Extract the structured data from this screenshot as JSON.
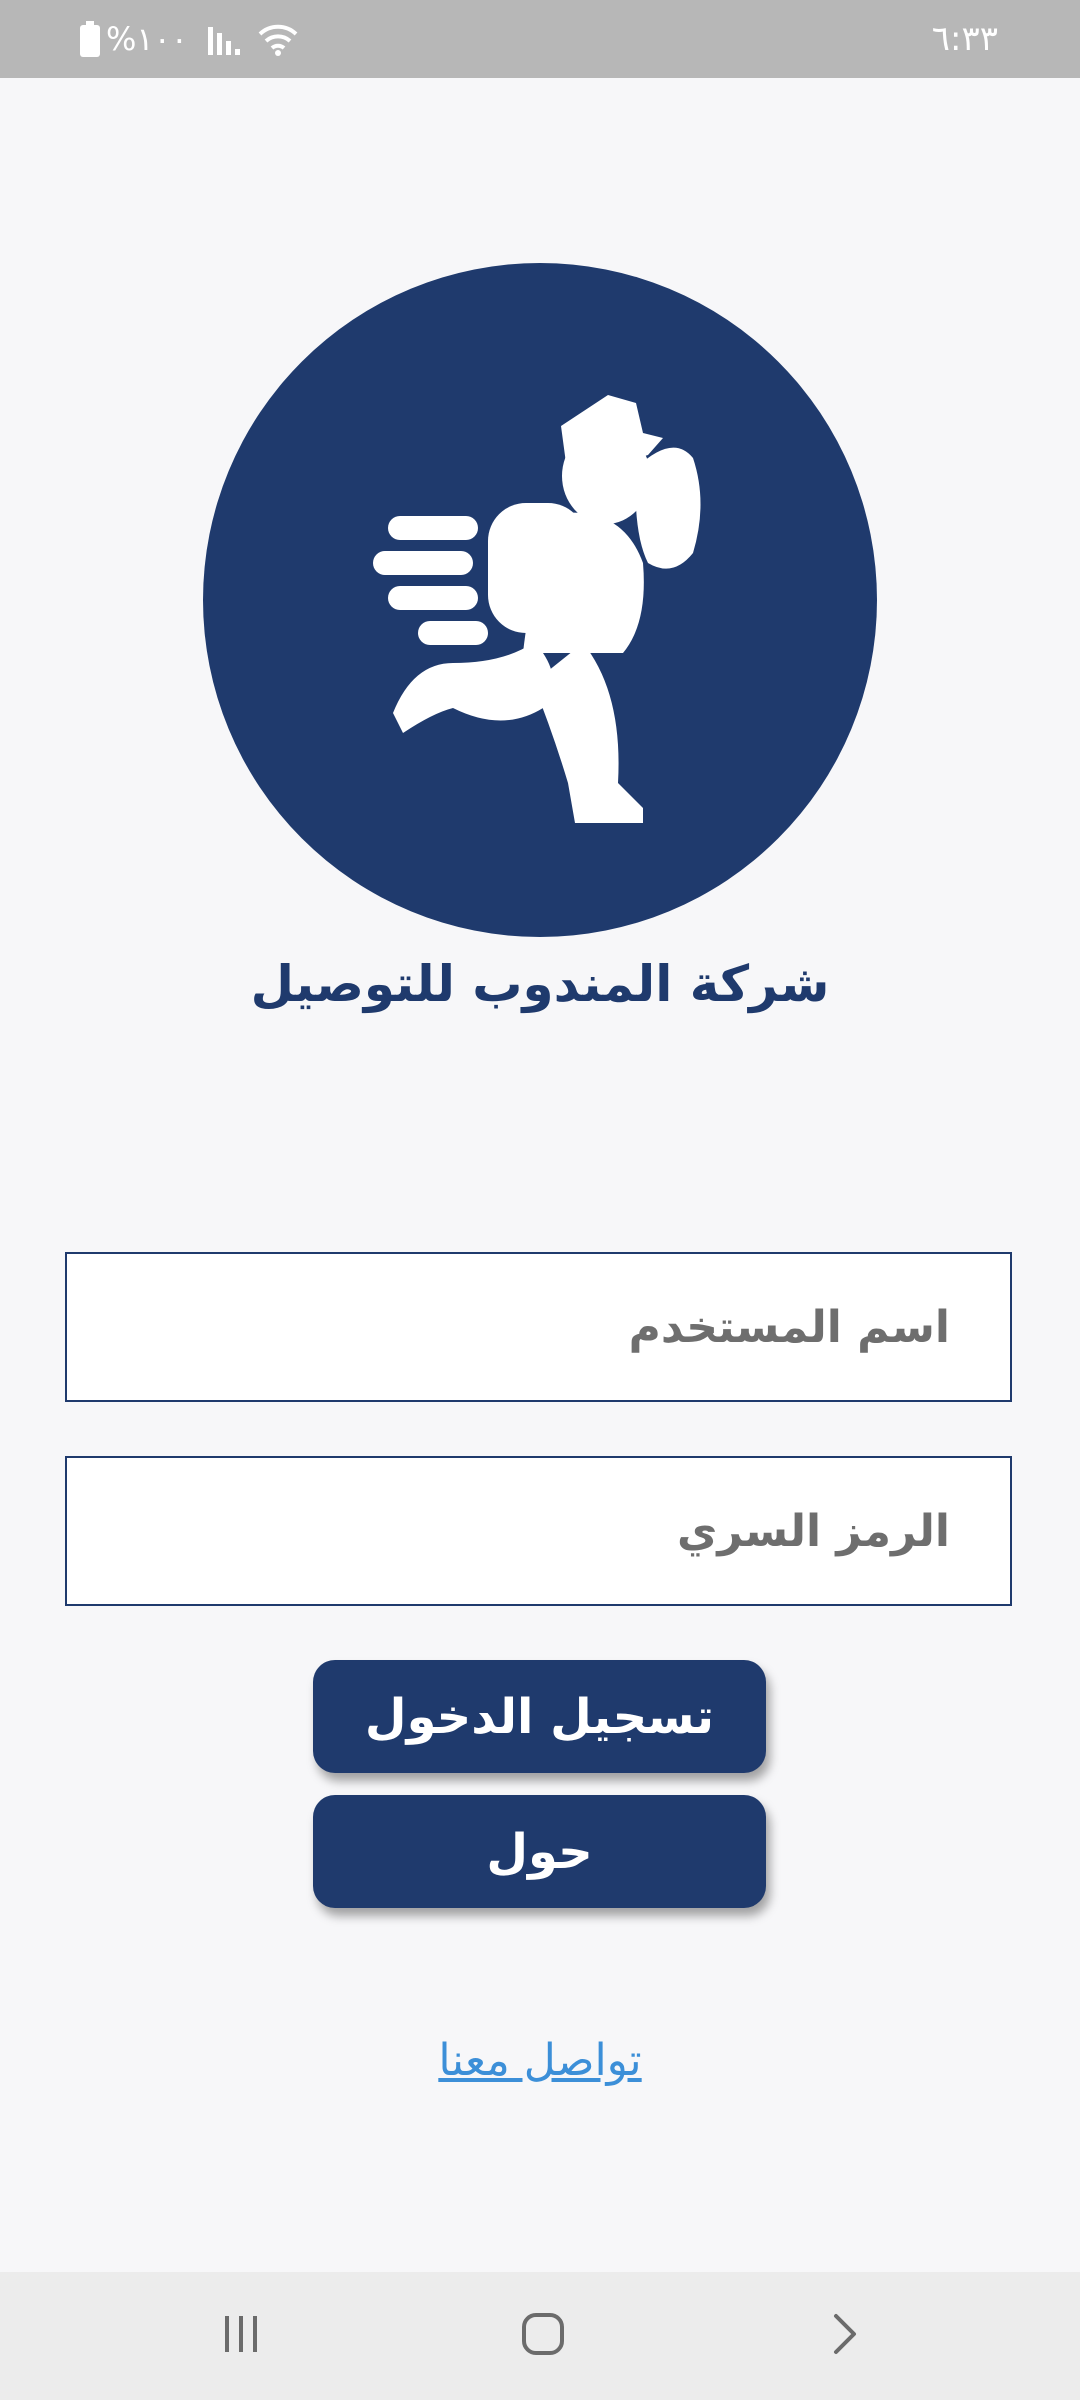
{
  "status_bar": {
    "battery_text": "%١٠٠",
    "time": "٦:٣٣",
    "icons": [
      "battery-icon",
      "signal-icon",
      "wifi-icon"
    ]
  },
  "logo": {
    "icon": "delivery-courier-icon",
    "circle_color": "#1f3a6d"
  },
  "company_name": "شركة المندوب للتوصيل",
  "form": {
    "username_placeholder": "اسم المستخدم",
    "password_placeholder": "الرمز السري"
  },
  "buttons": {
    "login_label": "تسجيل الدخول",
    "about_label": "حول"
  },
  "contact_link": "تواصل معنا",
  "nav_bar": {
    "icons": [
      "recent-apps-icon",
      "home-icon",
      "back-icon"
    ]
  },
  "colors": {
    "primary": "#1f3a6d",
    "link": "#3c8fd8",
    "background": "#f7f7f9"
  }
}
